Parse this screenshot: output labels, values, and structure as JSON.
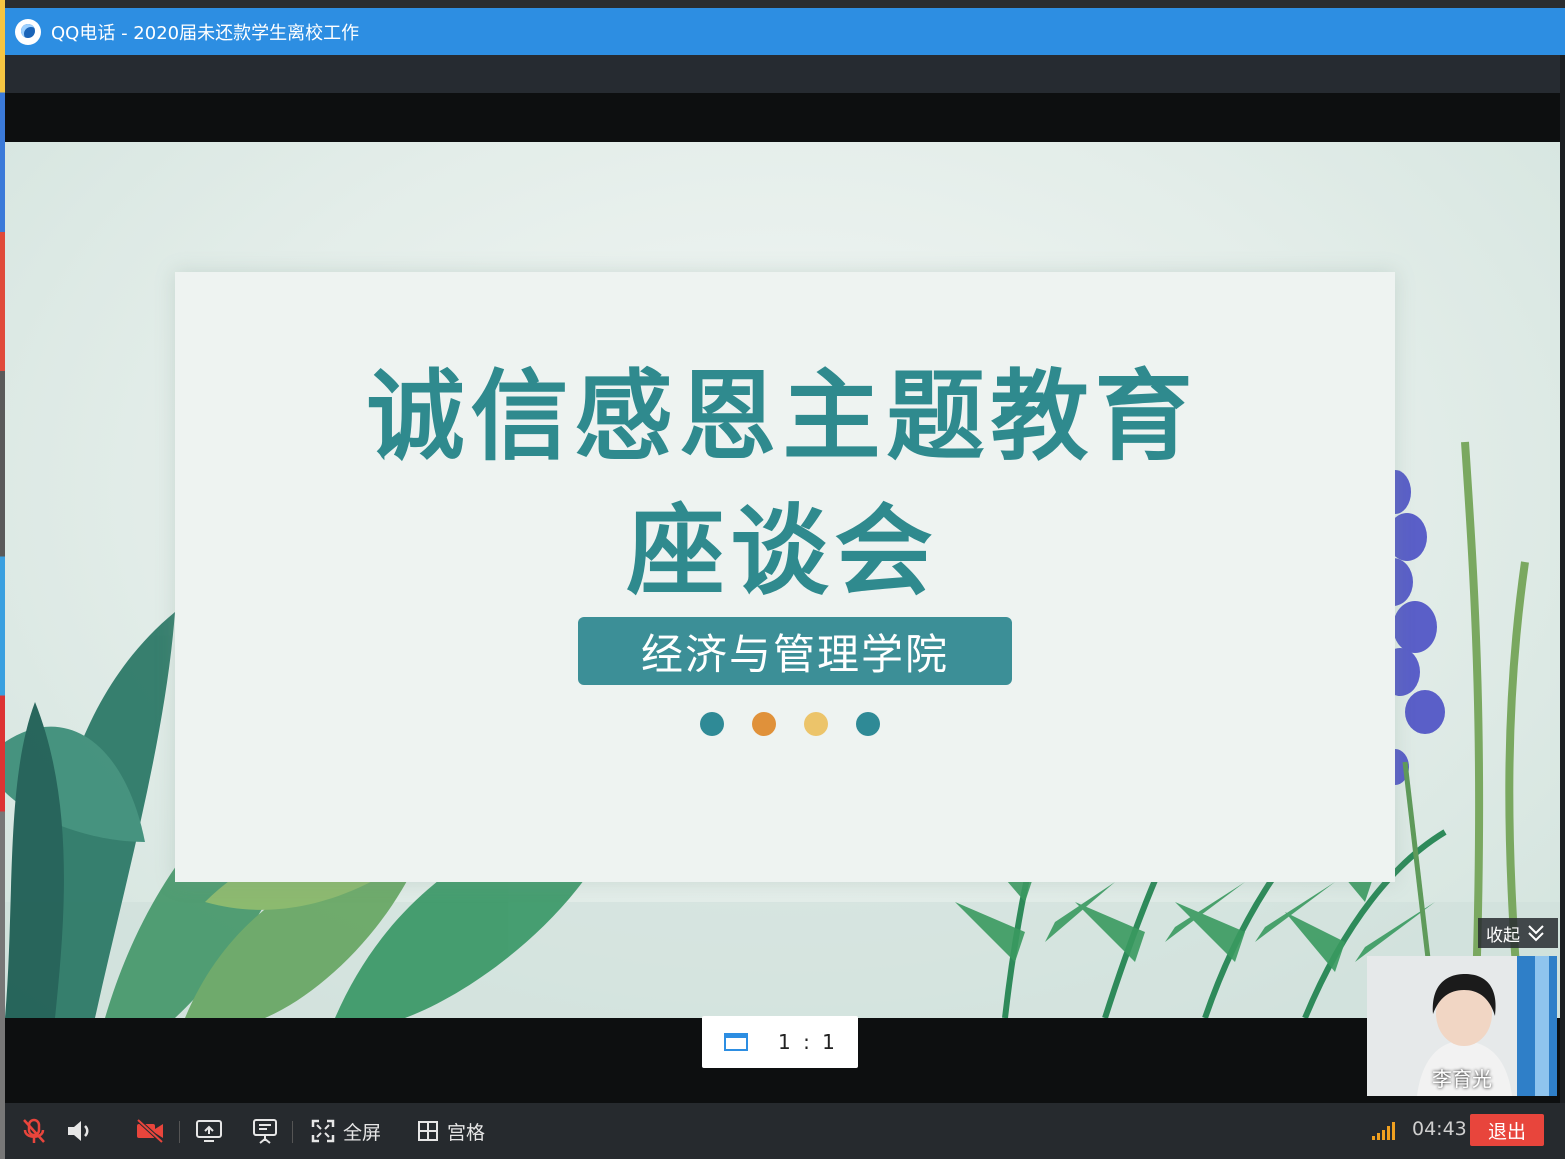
{
  "window": {
    "app_name": "QQ电话",
    "separator": " - ",
    "group_name": "2020届未还款学生离校工作"
  },
  "slide": {
    "title_line1": "诚信感恩主题教育",
    "title_line2": "座谈会",
    "subtitle": "经济与管理学院",
    "dot_colors": [
      "#2f8a96",
      "#e0913a",
      "#ecc46a",
      "#2f8a96"
    ]
  },
  "view": {
    "ratio_label": "1 : 1",
    "collapse_label": "收起"
  },
  "participant": {
    "name": "李育光"
  },
  "controls": {
    "fullscreen_label": "全屏",
    "grid_label": "宫格",
    "call_duration": "04:43",
    "exit_label": "退出"
  },
  "colors": {
    "titlebar": "#2d8ee2",
    "accent_teal": "#3c8f97",
    "exit_red": "#e8453c"
  }
}
